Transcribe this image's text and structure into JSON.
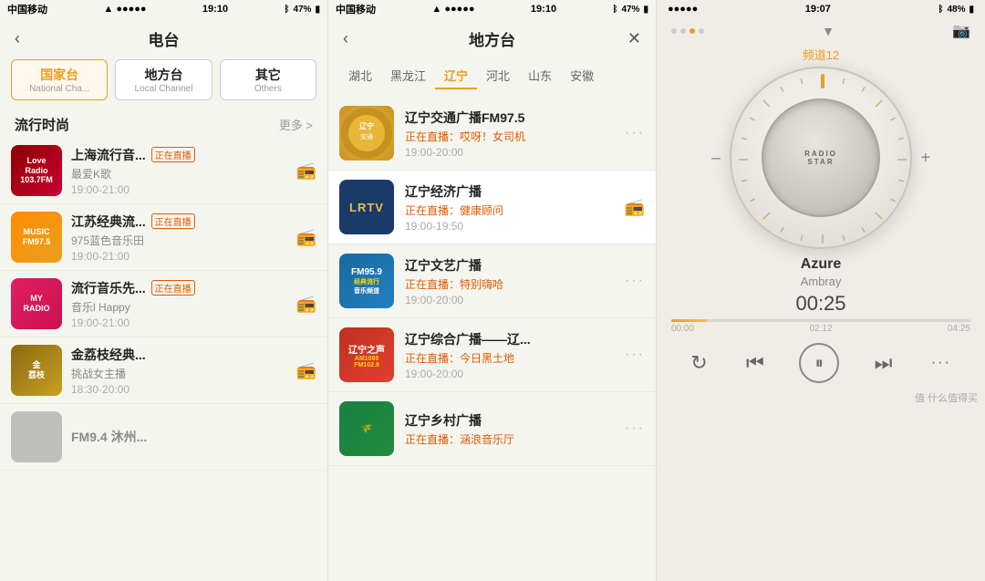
{
  "panels": {
    "left": {
      "statusBar": {
        "carrier": "中国移动",
        "signal": "●●●●●",
        "wifi": "▲",
        "time": "19:10",
        "bluetooth": "⁸",
        "battery": "47%"
      },
      "header": {
        "back": "‹",
        "title": "电台"
      },
      "tabs": [
        {
          "label": "国家台",
          "sub": "National Cha...",
          "active": true
        },
        {
          "label": "地方台",
          "sub": "Local Channel",
          "active": false
        },
        {
          "label": "其它",
          "sub": "Others",
          "active": false
        }
      ],
      "sectionTitle": "流行时尚",
      "moreLabel": "更多 >",
      "items": [
        {
          "name": "上海流行音...",
          "live": true,
          "liveText": "正在直播",
          "sub": "最爱K歌",
          "time": "19:00-21:00",
          "logoClass": "logo-love",
          "logoText": "Love\nRadio103.7FM"
        },
        {
          "name": "江苏经典流...",
          "live": true,
          "liveText": "正在直播",
          "sub": "975蓝色音乐田",
          "time": "19:00-21:00",
          "logoClass": "logo-music",
          "logoText": "MUSIC\nFM97.5"
        },
        {
          "name": "流行音乐先...",
          "live": true,
          "liveText": "正在直播",
          "sub": "音乐l Happy",
          "time": "19:00-21:00",
          "logoClass": "logo-myradio",
          "logoText": "MY RADIO"
        },
        {
          "name": "金荔枝经典...",
          "live": false,
          "sub": "挑战女主播",
          "time": "18:30-20:00",
          "logoClass": "logo-gold",
          "logoText": "金荔枝"
        }
      ]
    },
    "mid": {
      "statusBar": {
        "carrier": "中国移动",
        "signal": "●●●●●",
        "wifi": "▲",
        "time": "19:10",
        "bluetooth": "⁸",
        "battery": "47%"
      },
      "header": {
        "back": "‹",
        "title": "地方台",
        "close": "✕"
      },
      "regions": [
        "湖北",
        "黑龙江",
        "辽宁",
        "河北",
        "山东",
        "安徽"
      ],
      "activeRegion": "辽宁",
      "stations": [
        {
          "name": "辽宁交通广播FM97.5",
          "live": "正在直播：哎呀！女司机",
          "time": "19:00-20:00",
          "logoType": "gold-star",
          "highlighted": false
        },
        {
          "name": "辽宁经济广播",
          "live": "正在直播：健康顾问",
          "time": "19:00-19:50",
          "logoType": "lrtv",
          "highlighted": true
        },
        {
          "name": "辽宁文艺广播",
          "live": "正在直播：特别嗨哈",
          "time": "19:00-20:00",
          "logoType": "fm959",
          "highlighted": false
        },
        {
          "name": "辽宁综合广播——辽...",
          "live": "正在直播：今日黑土地",
          "time": "19:00-20:00",
          "logoType": "lnzy",
          "highlighted": false
        },
        {
          "name": "辽宁乡村广播",
          "live": "正在直播：涵浪音乐厅",
          "time": "",
          "logoType": "rural",
          "highlighted": false
        }
      ]
    },
    "right": {
      "statusBar": {
        "carrier": "●●●●●",
        "time": "19:07",
        "bluetooth": "⁸",
        "battery": "48%"
      },
      "channelLabel": "频道12",
      "downArrow": "▼",
      "cameraIcon": "📷",
      "dialLabel": "RADIO\nSTAR",
      "trackTitle": "Azure",
      "trackArtist": "Ambray",
      "trackTime": "00:25",
      "progress": {
        "current": "00:00",
        "mid": "02:12",
        "end": "04:25",
        "fillPercent": 12
      },
      "controls": {
        "repeat": "↻",
        "prev": "⏮",
        "playPause": "⏸",
        "next": "⏭",
        "more": "···"
      },
      "watermark": "值 什么值得买"
    }
  }
}
